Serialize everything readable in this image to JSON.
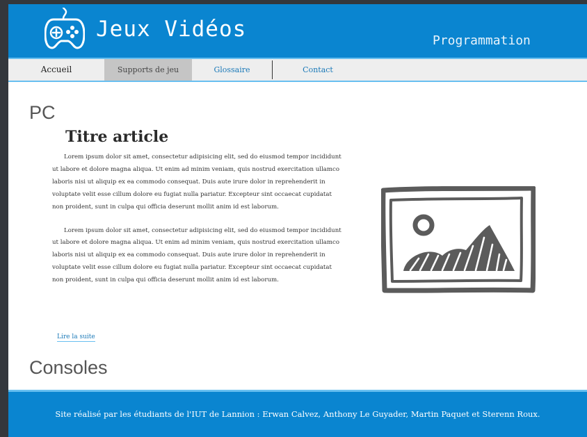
{
  "header": {
    "title": "Jeux Vidéos",
    "subtitle": "Programmation",
    "logo_icon": "gamepad-icon"
  },
  "nav": {
    "items": [
      {
        "label": "Accueil"
      },
      {
        "label": "Supports de jeu",
        "active": true
      },
      {
        "label": "Glossaire"
      },
      {
        "label": "Contact"
      }
    ]
  },
  "main": {
    "section_pc": "PC",
    "article": {
      "title": "Titre article",
      "paragraphs": [
        "Lorem ipsum dolor sit amet, consectetur adipisicing elit, sed do eiusmod tempor incididunt ut labore et dolore magna aliqua. Ut enim ad minim veniam, quis nostrud exercitation ullamco laboris nisi ut aliquip ex ea commodo consequat. Duis aute irure dolor in reprehenderit in voluptate velit esse cillum dolore eu fugiat nulla pariatur. Excepteur sint occaecat cupidatat non proident, sunt in culpa qui officia deserunt mollit anim id est laborum.",
        "Lorem ipsum dolor sit amet, consectetur adipisicing elit, sed do eiusmod tempor incididunt ut labore et dolore magna aliqua. Ut enim ad minim veniam, quis nostrud exercitation ullamco laboris nisi ut aliquip ex ea commodo consequat. Duis aute irure dolor in reprehenderit in voluptate velit esse cillum dolore eu fugiat nulla pariatur. Excepteur sint occaecat cupidatat non proident, sunt in culpa qui officia deserunt mollit anim id est laborum."
      ],
      "read_more": "Lire la suite",
      "image_icon": "image-placeholder-icon"
    },
    "section_consoles": "Consoles"
  },
  "footer": {
    "text": "Site réalisé par les étudiants de l'IUT de Lannion : Erwan Calvez, Anthony Le Guyader, Martin Paquet et Sterenn Roux."
  },
  "colors": {
    "brand_blue": "#0a85d0",
    "accent_light_blue": "#68bff0",
    "outer_background": "#34373c",
    "nav_active": "#c5c5c5"
  }
}
